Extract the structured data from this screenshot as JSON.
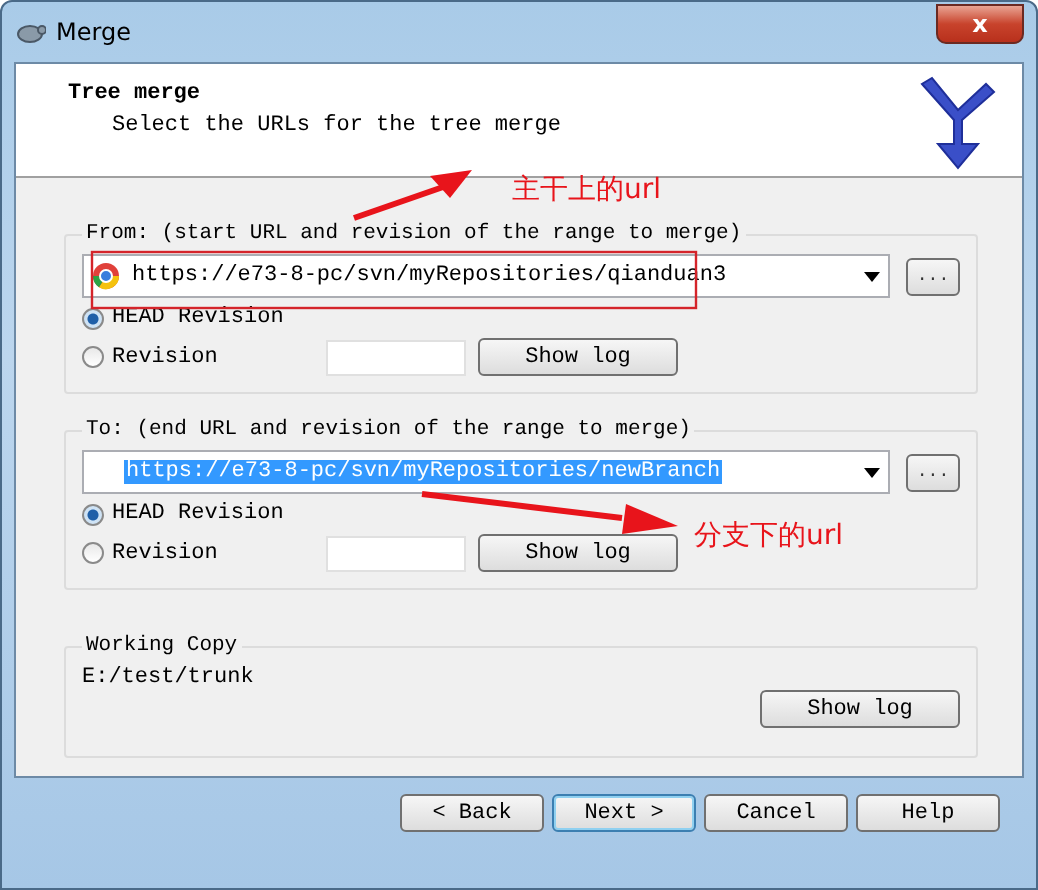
{
  "window": {
    "title": "Merge",
    "close": "x"
  },
  "header": {
    "title": "Tree merge",
    "subtitle": "Select the URLs for the tree merge"
  },
  "groups": [
    {
      "kind": "range",
      "legend": "From: (start URL and revision of the range to merge)",
      "url": "https://e73-8-pc/svn/myRepositories/qianduan3",
      "url_selected": false,
      "browse": "...",
      "options": [
        {
          "label": "HEAD Revision",
          "selected": true
        },
        {
          "label": "Revision",
          "selected": false
        }
      ],
      "show_log": "Show log"
    },
    {
      "kind": "range",
      "legend": "To: (end URL and revision of the range to merge)",
      "url": "https://e73-8-pc/svn/myRepositories/newBranch",
      "url_selected": true,
      "browse": "...",
      "options": [
        {
          "label": "HEAD Revision",
          "selected": true
        },
        {
          "label": "Revision",
          "selected": false
        }
      ],
      "show_log": "Show log"
    },
    {
      "kind": "working_copy",
      "legend": "Working Copy",
      "path": "E:/test/trunk",
      "show_log": "Show log"
    }
  ],
  "buttons": [
    {
      "label": "< Back",
      "default": false
    },
    {
      "label": "Next >",
      "default": true
    },
    {
      "label": "Cancel",
      "default": false
    },
    {
      "label": "Help",
      "default": false
    }
  ],
  "annotations": [
    {
      "text": "主干上的url"
    },
    {
      "text": "分支下的url"
    }
  ]
}
